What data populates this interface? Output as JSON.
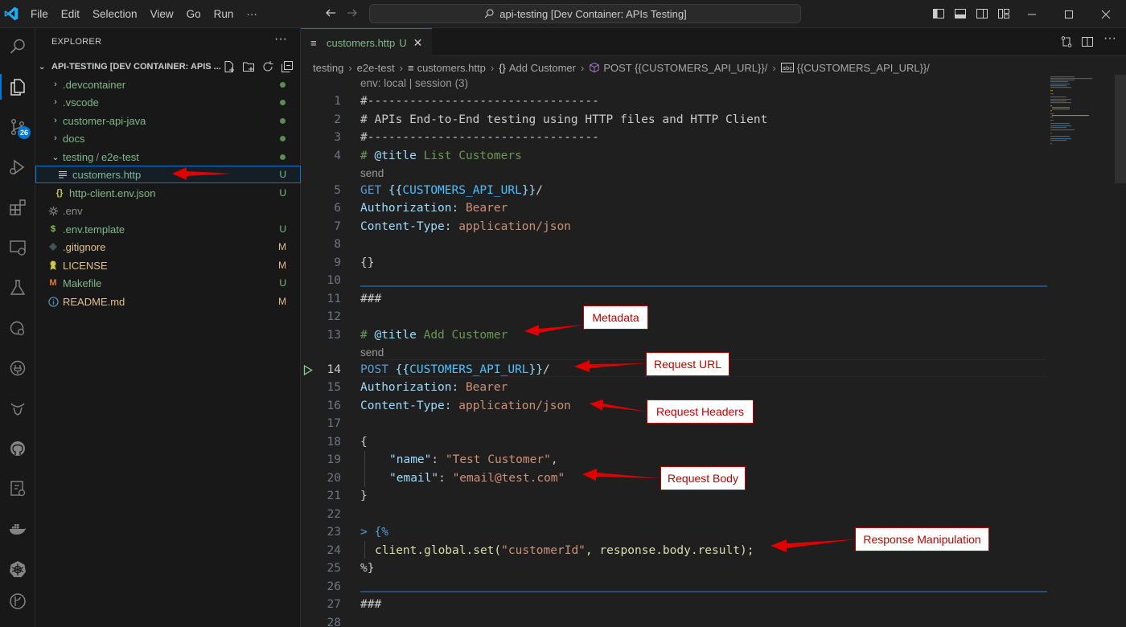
{
  "app": {
    "title_search": "api-testing [Dev Container: APIs Testing]",
    "menu": [
      "File",
      "Edit",
      "Selection",
      "View",
      "Go",
      "Run",
      "···"
    ]
  },
  "activity_bar": {
    "items": [
      {
        "icon": "files-icon"
      },
      {
        "icon": "search-icon"
      },
      {
        "icon": "source-control-icon",
        "badge": "26"
      },
      {
        "icon": "run-debug-icon"
      },
      {
        "icon": "extensions-icon"
      },
      {
        "icon": "remote-explorer-icon"
      },
      {
        "icon": "testing-icon"
      },
      {
        "icon": "timeline-icon"
      },
      {
        "icon": "api-icon"
      },
      {
        "icon": "gnu-icon"
      },
      {
        "icon": "github-icon"
      },
      {
        "icon": "dev-containers-icon"
      },
      {
        "icon": "docker-icon"
      },
      {
        "icon": "kubernetes-icon"
      },
      {
        "icon": "gitlens-icon"
      }
    ]
  },
  "explorer": {
    "header": "EXPLORER",
    "more": "···",
    "section_title": "API-TESTING [DEV CONTAINER: APIS ...",
    "items": [
      {
        "name": ".devcontainer",
        "kind": "folder",
        "status": "dot"
      },
      {
        "name": ".vscode",
        "kind": "folder",
        "status": "dot"
      },
      {
        "name": "customer-api-java",
        "kind": "folder",
        "status": "dot"
      },
      {
        "name": "docs",
        "kind": "folder",
        "status": "dot"
      },
      {
        "name": "testing",
        "name2": "e2e-test",
        "kind": "folder-open",
        "status": "dot"
      },
      {
        "name": "customers.http",
        "kind": "file",
        "status": "U"
      },
      {
        "name": "http-client.env.json",
        "kind": "json",
        "status": "U"
      },
      {
        "name": ".env",
        "kind": "gear",
        "status": ""
      },
      {
        "name": ".env.template",
        "kind": "dollar",
        "status": "U"
      },
      {
        "name": ".gitignore",
        "kind": "diamond",
        "status": "M"
      },
      {
        "name": "LICENSE",
        "kind": "license",
        "status": "M"
      },
      {
        "name": "Makefile",
        "kind": "makefile",
        "status": "U"
      },
      {
        "name": "README.md",
        "kind": "info",
        "status": "M"
      }
    ]
  },
  "tab": {
    "name": "customers.http",
    "status": "U",
    "close": "✕"
  },
  "breadcrumbs": {
    "parts": [
      "testing",
      "e2e-test",
      "customers.http",
      "Add Customer",
      "POST {{CUSTOMERS_API_URL}}/",
      "{{CUSTOMERS_API_URL}}/"
    ],
    "icons": {
      "file": "≡",
      "braces": "{}"
    }
  },
  "codelens": {
    "env": "env: local | session (3)",
    "send1": "send",
    "send2": "send"
  },
  "code": {
    "l1": "#---------------------------------",
    "l2": "# APIs End-to-End testing using HTTP files and HTTP Client",
    "l3": "#---------------------------------",
    "l4_hash": "# ",
    "l4_tag": "@title",
    "l4_val": " List Customers",
    "l5_method": "GET",
    "l5_open": " {{",
    "l5_var": "CUSTOMERS_API_URL",
    "l5_close": "}}",
    "l5_slash": "/",
    "l6_name": "Authorization:",
    "l6_val": " Bearer",
    "l7_name": "Content-Type:",
    "l7_val": " application/json",
    "l9": "{}",
    "l11": "###",
    "l13_hash": "# ",
    "l13_tag": "@title",
    "l13_val": " Add Customer",
    "l14_method": "POST",
    "l14_open": " {{",
    "l14_var": "CUSTOMERS_API_URL",
    "l14_close": "}}",
    "l14_slash": "/",
    "l15_name": "Authorization:",
    "l15_val": " Bearer",
    "l16_name": "Content-Type:",
    "l16_val": " application/json",
    "l18": "{",
    "l19_key": "\"name\"",
    "l19_colon": ": ",
    "l19_val": "\"Test Customer\"",
    "l19_comma": ",",
    "l20_key": "\"email\"",
    "l20_colon": ": ",
    "l20_val": "\"email@test.com\"",
    "l21": "}",
    "l23_chev": "> ",
    "l23": "{%",
    "l24_fn": "client.global.set(",
    "l24_str": "\"customerId\"",
    "l24_rest": ", response.body.result);",
    "l25": "%}",
    "l27": "###"
  },
  "line_numbers": [
    "1",
    "2",
    "3",
    "4",
    "5",
    "6",
    "7",
    "8",
    "9",
    "10",
    "11",
    "12",
    "13",
    "14",
    "15",
    "16",
    "17",
    "18",
    "19",
    "20",
    "21",
    "22",
    "23",
    "24",
    "25",
    "26",
    "27",
    "28"
  ],
  "annotations": {
    "metadata": "Metadata",
    "request_url": "Request URL",
    "request_headers": "Request Headers",
    "request_body": "Request Body",
    "response_manipulation": "Response Manipulation"
  },
  "colors": {
    "accent": "#0078d4",
    "annotation": "#e00000",
    "untracked": "#81b88b",
    "modified": "#e2c08d"
  }
}
